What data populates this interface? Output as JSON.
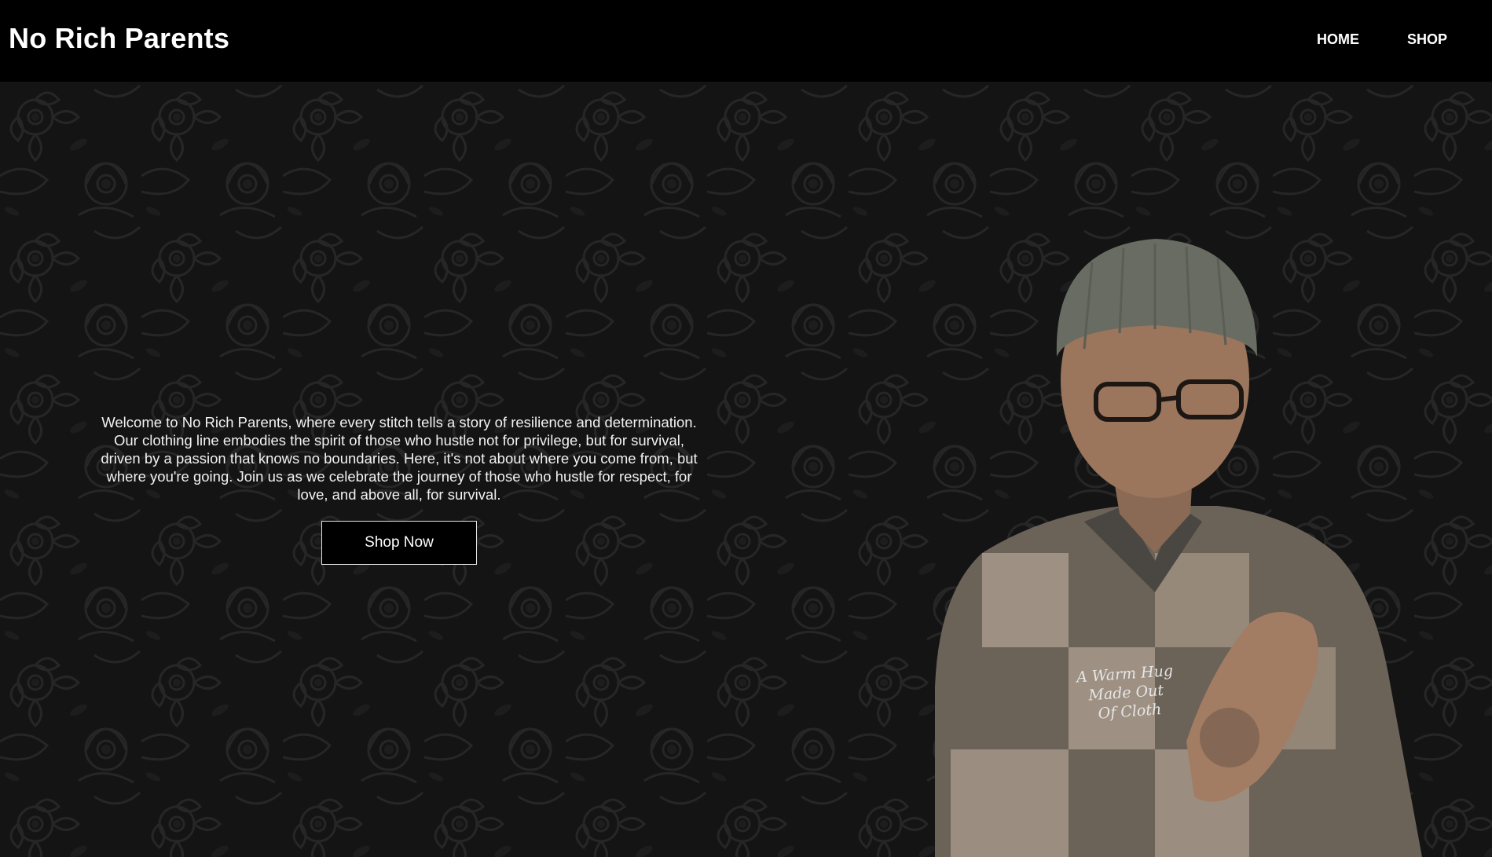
{
  "header": {
    "brand": "No Rich Parents",
    "nav": [
      {
        "label": "HOME"
      },
      {
        "label": "SHOP"
      }
    ]
  },
  "hero": {
    "text": "Welcome to No Rich Parents, where every stitch tells a story of resilience and determination. Our clothing line embodies the spirit of those who hustle not for privilege, but for survival, driven by a passion that knows no boundaries. Here, it's not about where you come from, but where you're going. Join us as we celebrate the journey of those who hustle for respect, for love, and above all, for survival.",
    "cta_label": "Shop Now",
    "shirt_script": "A Warm Hug Made Out Of Cloth"
  },
  "colors": {
    "background": "#000000",
    "pattern": "#1c1c1c",
    "text": "#ffffff"
  }
}
